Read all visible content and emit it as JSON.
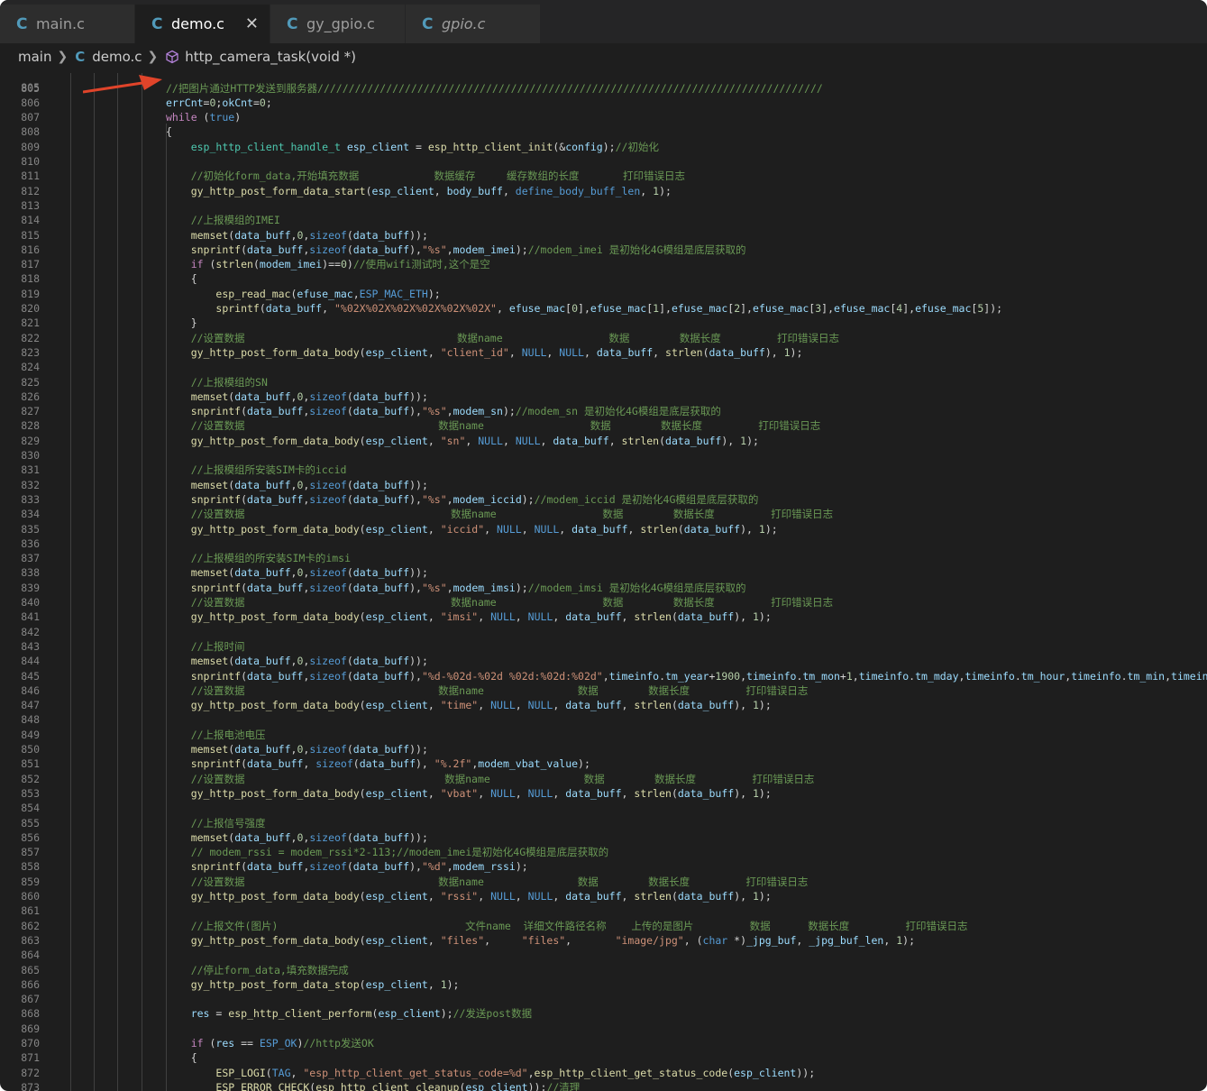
{
  "tabs": [
    {
      "icon": "C",
      "label": "main.c"
    },
    {
      "icon": "C",
      "label": "demo.c",
      "close": "✕"
    },
    {
      "icon": "C",
      "label": "gy_gpio.c"
    },
    {
      "icon": "C",
      "label": "gpio.c"
    }
  ],
  "breadcrumb": {
    "folder": "main",
    "file_icon": "C",
    "file": "demo.c",
    "symbol": "http_camera_task(void *)"
  },
  "editor": {
    "top_partial_line_number": "805",
    "lines": [
      {
        "n": "805",
        "text": "//把图片通过HTTP发送到服务器/////////////////////////////////////////////////////////////////////////////////"
      },
      {
        "n": "806",
        "text": "errCnt=0;okCnt=0;"
      },
      {
        "n": "807",
        "text": "while (true)"
      },
      {
        "n": "808",
        "text": "{"
      },
      {
        "n": "809",
        "text": "    esp_http_client_handle_t esp_client = esp_http_client_init(&config);//初始化"
      },
      {
        "n": "810",
        "text": ""
      },
      {
        "n": "811",
        "text": "    //初始化form_data,开始填充数据            数据缓存     缓存数组的长度       打印错误日志"
      },
      {
        "n": "812",
        "text": "    gy_http_post_form_data_start(esp_client, body_buff, define_body_buff_len, 1);"
      },
      {
        "n": "813",
        "text": ""
      },
      {
        "n": "814",
        "text": "    //上报模组的IMEI"
      },
      {
        "n": "815",
        "text": "    memset(data_buff,0,sizeof(data_buff));"
      },
      {
        "n": "816",
        "text": "    snprintf(data_buff,sizeof(data_buff),\"%s\",modem_imei);//modem_imei 是初始化4G模组是底层获取的"
      },
      {
        "n": "817",
        "text": "    if (strlen(modem_imei)==0)//使用wifi测试时,这个是空"
      },
      {
        "n": "818",
        "text": "    {"
      },
      {
        "n": "819",
        "text": "        esp_read_mac(efuse_mac,ESP_MAC_ETH);"
      },
      {
        "n": "820",
        "text": "        sprintf(data_buff, \"%02X%02X%02X%02X%02X%02X\", efuse_mac[0],efuse_mac[1],efuse_mac[2],efuse_mac[3],efuse_mac[4],efuse_mac[5]);"
      },
      {
        "n": "821",
        "text": "    }"
      },
      {
        "n": "822",
        "text": "    //设置数据                                  数据name                 数据        数据长度         打印错误日志"
      },
      {
        "n": "823",
        "text": "    gy_http_post_form_data_body(esp_client, \"client_id\", NULL, NULL, data_buff, strlen(data_buff), 1);"
      },
      {
        "n": "824",
        "text": ""
      },
      {
        "n": "825",
        "text": "    //上报模组的SN"
      },
      {
        "n": "826",
        "text": "    memset(data_buff,0,sizeof(data_buff));"
      },
      {
        "n": "827",
        "text": "    snprintf(data_buff,sizeof(data_buff),\"%s\",modem_sn);//modem_sn 是初始化4G模组是底层获取的"
      },
      {
        "n": "828",
        "text": "    //设置数据                               数据name                 数据        数据长度         打印错误日志"
      },
      {
        "n": "829",
        "text": "    gy_http_post_form_data_body(esp_client, \"sn\", NULL, NULL, data_buff, strlen(data_buff), 1);"
      },
      {
        "n": "830",
        "text": ""
      },
      {
        "n": "831",
        "text": "    //上报模组所安装SIM卡的iccid"
      },
      {
        "n": "832",
        "text": "    memset(data_buff,0,sizeof(data_buff));"
      },
      {
        "n": "833",
        "text": "    snprintf(data_buff,sizeof(data_buff),\"%s\",modem_iccid);//modem_iccid 是初始化4G模组是底层获取的"
      },
      {
        "n": "834",
        "text": "    //设置数据                                 数据name                 数据        数据长度         打印错误日志"
      },
      {
        "n": "835",
        "text": "    gy_http_post_form_data_body(esp_client, \"iccid\", NULL, NULL, data_buff, strlen(data_buff), 1);"
      },
      {
        "n": "836",
        "text": ""
      },
      {
        "n": "837",
        "text": "    //上报模组的所安装SIM卡的imsi"
      },
      {
        "n": "838",
        "text": "    memset(data_buff,0,sizeof(data_buff));"
      },
      {
        "n": "839",
        "text": "    snprintf(data_buff,sizeof(data_buff),\"%s\",modem_imsi);//modem_imsi 是初始化4G模组是底层获取的"
      },
      {
        "n": "840",
        "text": "    //设置数据                                 数据name                 数据        数据长度         打印错误日志"
      },
      {
        "n": "841",
        "text": "    gy_http_post_form_data_body(esp_client, \"imsi\", NULL, NULL, data_buff, strlen(data_buff), 1);"
      },
      {
        "n": "842",
        "text": ""
      },
      {
        "n": "843",
        "text": "    //上报时间"
      },
      {
        "n": "844",
        "text": "    memset(data_buff,0,sizeof(data_buff));"
      },
      {
        "n": "845",
        "text": "    snprintf(data_buff,sizeof(data_buff),\"%d-%02d-%02d %02d:%02d:%02d\",timeinfo.tm_year+1900,timeinfo.tm_mon+1,timeinfo.tm_mday,timeinfo.tm_hour,timeinfo.tm_min,timeinfo.tm"
      },
      {
        "n": "846",
        "text": "    //设置数据                               数据name               数据        数据长度         打印错误日志"
      },
      {
        "n": "847",
        "text": "    gy_http_post_form_data_body(esp_client, \"time\", NULL, NULL, data_buff, strlen(data_buff), 1);"
      },
      {
        "n": "848",
        "text": ""
      },
      {
        "n": "849",
        "text": "    //上报电池电压"
      },
      {
        "n": "850",
        "text": "    memset(data_buff,0,sizeof(data_buff));"
      },
      {
        "n": "851",
        "text": "    snprintf(data_buff, sizeof(data_buff), \"%.2f\",modem_vbat_value);"
      },
      {
        "n": "852",
        "text": "    //设置数据                                数据name               数据        数据长度         打印错误日志"
      },
      {
        "n": "853",
        "text": "    gy_http_post_form_data_body(esp_client, \"vbat\", NULL, NULL, data_buff, strlen(data_buff), 1);"
      },
      {
        "n": "854",
        "text": ""
      },
      {
        "n": "855",
        "text": "    //上报信号强度"
      },
      {
        "n": "856",
        "text": "    memset(data_buff,0,sizeof(data_buff));"
      },
      {
        "n": "857",
        "text": "    // modem_rssi = modem_rssi*2-113;//modem_imei是初始化4G模组是底层获取的"
      },
      {
        "n": "858",
        "text": "    snprintf(data_buff,sizeof(data_buff),\"%d\",modem_rssi);"
      },
      {
        "n": "859",
        "text": "    //设置数据                               数据name               数据        数据长度         打印错误日志"
      },
      {
        "n": "860",
        "text": "    gy_http_post_form_data_body(esp_client, \"rssi\", NULL, NULL, data_buff, strlen(data_buff), 1);"
      },
      {
        "n": "861",
        "text": ""
      },
      {
        "n": "862",
        "text": "    //上报文件(图片)                              文件name  详细文件路径名称    上传的是图片         数据      数据长度         打印错误日志"
      },
      {
        "n": "863",
        "text": "    gy_http_post_form_data_body(esp_client, \"files\",     \"files\",       \"image/jpg\", (char *)_jpg_buf, _jpg_buf_len, 1);"
      },
      {
        "n": "864",
        "text": ""
      },
      {
        "n": "865",
        "text": "    //停止form_data,填充数据完成"
      },
      {
        "n": "866",
        "text": "    gy_http_post_form_data_stop(esp_client, 1);"
      },
      {
        "n": "867",
        "text": ""
      },
      {
        "n": "868",
        "text": "    res = esp_http_client_perform(esp_client);//发送post数据"
      },
      {
        "n": "869",
        "text": ""
      },
      {
        "n": "870",
        "text": "    if (res == ESP_OK)//http发送OK"
      },
      {
        "n": "871",
        "text": "    {"
      },
      {
        "n": "872",
        "text": "        ESP_LOGI(TAG, \"esp_http_client_get_status_code=%d\",esp_http_client_get_status_code(esp_client));"
      },
      {
        "n": "873",
        "text": "        ESP_ERROR_CHECK(esp_http_client_cleanup(esp_client));//清理"
      },
      {
        "n": "874",
        "text": ""
      }
    ]
  },
  "colors": {
    "background": "#1e1e1e",
    "tabbar": "#252526",
    "keyword": "#569cd6",
    "string": "#ce9178",
    "comment": "#6a9955",
    "function": "#dcdcaa",
    "variable": "#9cdcfe",
    "number": "#b5cea8",
    "type": "#4ec9b0",
    "annotation_arrow": "#e0442a"
  }
}
